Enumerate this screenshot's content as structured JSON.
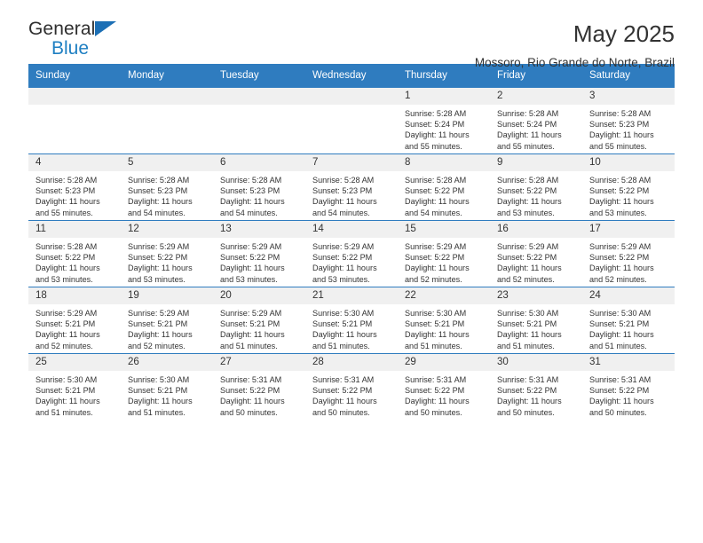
{
  "brand": {
    "name_top": "General",
    "name_bottom": "Blue",
    "accent_color": "#1c6fb5"
  },
  "header": {
    "title": "May 2025",
    "subtitle": "Mossoro, Rio Grande do Norte, Brazil"
  },
  "calendar": {
    "header_bg": "#2f7cbf",
    "daynum_bg": "#f0f0f0",
    "weekday_headers": [
      "Sunday",
      "Monday",
      "Tuesday",
      "Wednesday",
      "Thursday",
      "Friday",
      "Saturday"
    ],
    "weeks": [
      [
        {
          "day": "",
          "empty": true
        },
        {
          "day": "",
          "empty": true
        },
        {
          "day": "",
          "empty": true
        },
        {
          "day": "",
          "empty": true
        },
        {
          "day": "1",
          "sunrise": "Sunrise: 5:28 AM",
          "sunset": "Sunset: 5:24 PM",
          "daylight_line1": "Daylight: 11 hours",
          "daylight_line2": "and 55 minutes."
        },
        {
          "day": "2",
          "sunrise": "Sunrise: 5:28 AM",
          "sunset": "Sunset: 5:24 PM",
          "daylight_line1": "Daylight: 11 hours",
          "daylight_line2": "and 55 minutes."
        },
        {
          "day": "3",
          "sunrise": "Sunrise: 5:28 AM",
          "sunset": "Sunset: 5:23 PM",
          "daylight_line1": "Daylight: 11 hours",
          "daylight_line2": "and 55 minutes."
        }
      ],
      [
        {
          "day": "4",
          "sunrise": "Sunrise: 5:28 AM",
          "sunset": "Sunset: 5:23 PM",
          "daylight_line1": "Daylight: 11 hours",
          "daylight_line2": "and 55 minutes."
        },
        {
          "day": "5",
          "sunrise": "Sunrise: 5:28 AM",
          "sunset": "Sunset: 5:23 PM",
          "daylight_line1": "Daylight: 11 hours",
          "daylight_line2": "and 54 minutes."
        },
        {
          "day": "6",
          "sunrise": "Sunrise: 5:28 AM",
          "sunset": "Sunset: 5:23 PM",
          "daylight_line1": "Daylight: 11 hours",
          "daylight_line2": "and 54 minutes."
        },
        {
          "day": "7",
          "sunrise": "Sunrise: 5:28 AM",
          "sunset": "Sunset: 5:23 PM",
          "daylight_line1": "Daylight: 11 hours",
          "daylight_line2": "and 54 minutes."
        },
        {
          "day": "8",
          "sunrise": "Sunrise: 5:28 AM",
          "sunset": "Sunset: 5:22 PM",
          "daylight_line1": "Daylight: 11 hours",
          "daylight_line2": "and 54 minutes."
        },
        {
          "day": "9",
          "sunrise": "Sunrise: 5:28 AM",
          "sunset": "Sunset: 5:22 PM",
          "daylight_line1": "Daylight: 11 hours",
          "daylight_line2": "and 53 minutes."
        },
        {
          "day": "10",
          "sunrise": "Sunrise: 5:28 AM",
          "sunset": "Sunset: 5:22 PM",
          "daylight_line1": "Daylight: 11 hours",
          "daylight_line2": "and 53 minutes."
        }
      ],
      [
        {
          "day": "11",
          "sunrise": "Sunrise: 5:28 AM",
          "sunset": "Sunset: 5:22 PM",
          "daylight_line1": "Daylight: 11 hours",
          "daylight_line2": "and 53 minutes."
        },
        {
          "day": "12",
          "sunrise": "Sunrise: 5:29 AM",
          "sunset": "Sunset: 5:22 PM",
          "daylight_line1": "Daylight: 11 hours",
          "daylight_line2": "and 53 minutes."
        },
        {
          "day": "13",
          "sunrise": "Sunrise: 5:29 AM",
          "sunset": "Sunset: 5:22 PM",
          "daylight_line1": "Daylight: 11 hours",
          "daylight_line2": "and 53 minutes."
        },
        {
          "day": "14",
          "sunrise": "Sunrise: 5:29 AM",
          "sunset": "Sunset: 5:22 PM",
          "daylight_line1": "Daylight: 11 hours",
          "daylight_line2": "and 53 minutes."
        },
        {
          "day": "15",
          "sunrise": "Sunrise: 5:29 AM",
          "sunset": "Sunset: 5:22 PM",
          "daylight_line1": "Daylight: 11 hours",
          "daylight_line2": "and 52 minutes."
        },
        {
          "day": "16",
          "sunrise": "Sunrise: 5:29 AM",
          "sunset": "Sunset: 5:22 PM",
          "daylight_line1": "Daylight: 11 hours",
          "daylight_line2": "and 52 minutes."
        },
        {
          "day": "17",
          "sunrise": "Sunrise: 5:29 AM",
          "sunset": "Sunset: 5:22 PM",
          "daylight_line1": "Daylight: 11 hours",
          "daylight_line2": "and 52 minutes."
        }
      ],
      [
        {
          "day": "18",
          "sunrise": "Sunrise: 5:29 AM",
          "sunset": "Sunset: 5:21 PM",
          "daylight_line1": "Daylight: 11 hours",
          "daylight_line2": "and 52 minutes."
        },
        {
          "day": "19",
          "sunrise": "Sunrise: 5:29 AM",
          "sunset": "Sunset: 5:21 PM",
          "daylight_line1": "Daylight: 11 hours",
          "daylight_line2": "and 52 minutes."
        },
        {
          "day": "20",
          "sunrise": "Sunrise: 5:29 AM",
          "sunset": "Sunset: 5:21 PM",
          "daylight_line1": "Daylight: 11 hours",
          "daylight_line2": "and 51 minutes."
        },
        {
          "day": "21",
          "sunrise": "Sunrise: 5:30 AM",
          "sunset": "Sunset: 5:21 PM",
          "daylight_line1": "Daylight: 11 hours",
          "daylight_line2": "and 51 minutes."
        },
        {
          "day": "22",
          "sunrise": "Sunrise: 5:30 AM",
          "sunset": "Sunset: 5:21 PM",
          "daylight_line1": "Daylight: 11 hours",
          "daylight_line2": "and 51 minutes."
        },
        {
          "day": "23",
          "sunrise": "Sunrise: 5:30 AM",
          "sunset": "Sunset: 5:21 PM",
          "daylight_line1": "Daylight: 11 hours",
          "daylight_line2": "and 51 minutes."
        },
        {
          "day": "24",
          "sunrise": "Sunrise: 5:30 AM",
          "sunset": "Sunset: 5:21 PM",
          "daylight_line1": "Daylight: 11 hours",
          "daylight_line2": "and 51 minutes."
        }
      ],
      [
        {
          "day": "25",
          "sunrise": "Sunrise: 5:30 AM",
          "sunset": "Sunset: 5:21 PM",
          "daylight_line1": "Daylight: 11 hours",
          "daylight_line2": "and 51 minutes."
        },
        {
          "day": "26",
          "sunrise": "Sunrise: 5:30 AM",
          "sunset": "Sunset: 5:21 PM",
          "daylight_line1": "Daylight: 11 hours",
          "daylight_line2": "and 51 minutes."
        },
        {
          "day": "27",
          "sunrise": "Sunrise: 5:31 AM",
          "sunset": "Sunset: 5:22 PM",
          "daylight_line1": "Daylight: 11 hours",
          "daylight_line2": "and 50 minutes."
        },
        {
          "day": "28",
          "sunrise": "Sunrise: 5:31 AM",
          "sunset": "Sunset: 5:22 PM",
          "daylight_line1": "Daylight: 11 hours",
          "daylight_line2": "and 50 minutes."
        },
        {
          "day": "29",
          "sunrise": "Sunrise: 5:31 AM",
          "sunset": "Sunset: 5:22 PM",
          "daylight_line1": "Daylight: 11 hours",
          "daylight_line2": "and 50 minutes."
        },
        {
          "day": "30",
          "sunrise": "Sunrise: 5:31 AM",
          "sunset": "Sunset: 5:22 PM",
          "daylight_line1": "Daylight: 11 hours",
          "daylight_line2": "and 50 minutes."
        },
        {
          "day": "31",
          "sunrise": "Sunrise: 5:31 AM",
          "sunset": "Sunset: 5:22 PM",
          "daylight_line1": "Daylight: 11 hours",
          "daylight_line2": "and 50 minutes."
        }
      ]
    ]
  }
}
